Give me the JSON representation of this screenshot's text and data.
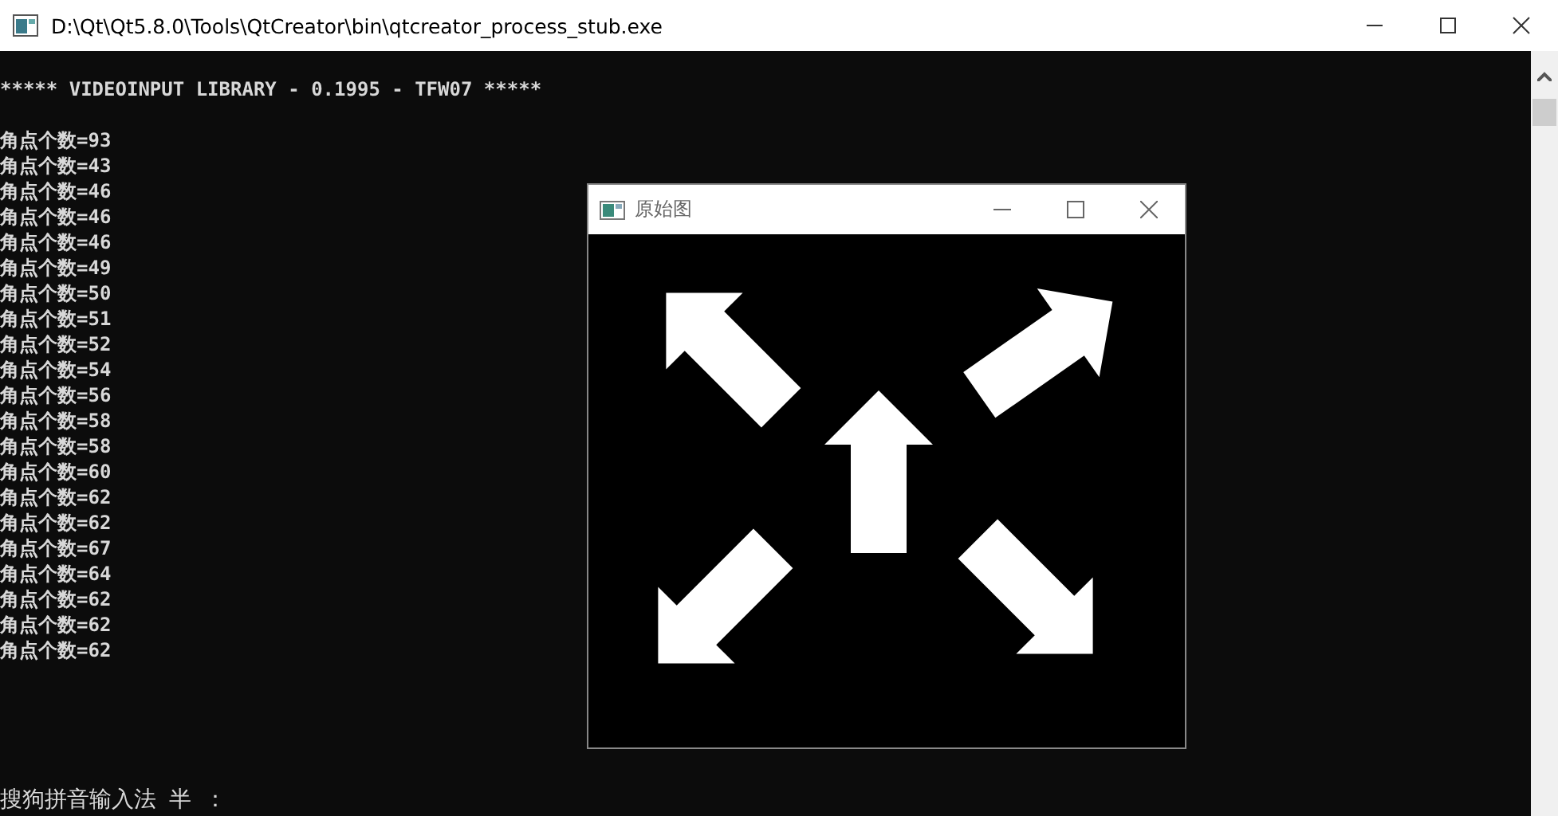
{
  "window": {
    "title": "D:\\Qt\\Qt5.8.0\\Tools\\QtCreator\\bin\\qtcreator_process_stub.exe"
  },
  "console": {
    "header": "***** VIDEOINPUT LIBRARY - 0.1995 - TFW07 *****",
    "lines": [
      "角点个数=93",
      "角点个数=43",
      "角点个数=46",
      "角点个数=46",
      "角点个数=46",
      "角点个数=49",
      "角点个数=50",
      "角点个数=51",
      "角点个数=52",
      "角点个数=54",
      "角点个数=56",
      "角点个数=58",
      "角点个数=58",
      "角点个数=60",
      "角点个数=62",
      "角点个数=62",
      "角点个数=67",
      "角点个数=64",
      "角点个数=62",
      "角点个数=62",
      "角点个数=62"
    ],
    "ime": {
      "name": "搜狗拼音输入法",
      "mode": "半",
      "punct": "："
    }
  },
  "image_window": {
    "title": "原始图"
  }
}
